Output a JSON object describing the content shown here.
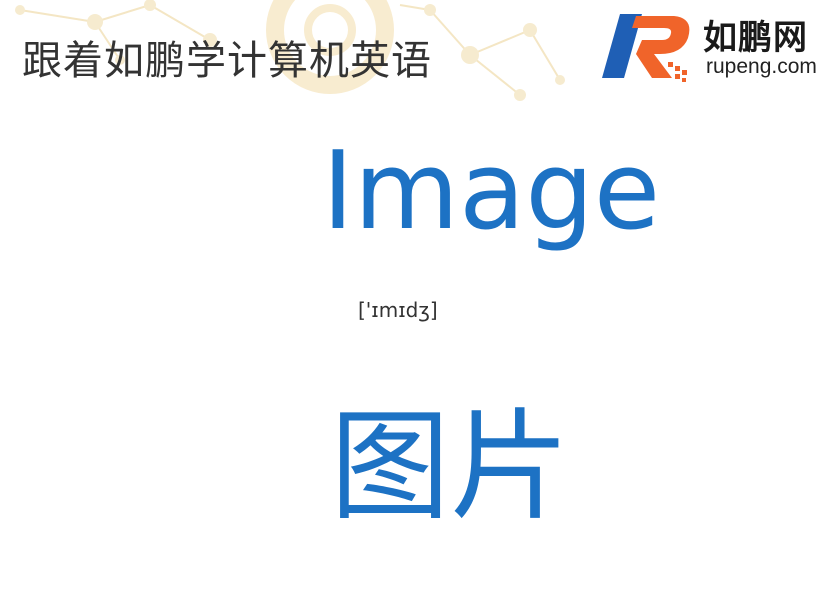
{
  "header": {
    "title": "跟着如鹏学计算机英语"
  },
  "brand": {
    "name": "如鹏网",
    "domain": "rupeng.com",
    "logo_letter": "R",
    "colors": {
      "blue": "#1f5fb5",
      "orange": "#f0642a"
    }
  },
  "card": {
    "word": "Image",
    "phonetic": "['ɪmɪdʒ]",
    "meaning": "图片",
    "word_color": "#1d72c4"
  },
  "decoration": {
    "style": "faint network nodes and ring watermark",
    "color": "#f3e2b6"
  }
}
